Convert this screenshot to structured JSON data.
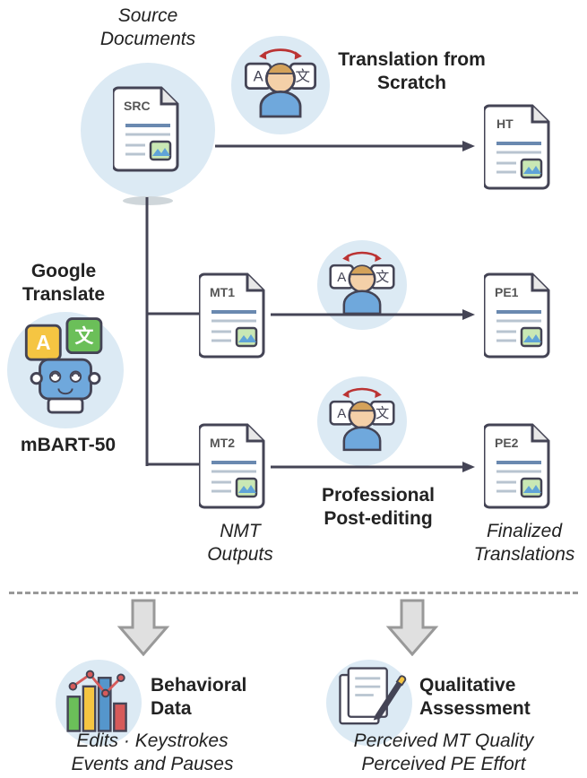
{
  "labels": {
    "source_documents": "Source Documents",
    "translation_from_scratch": "Translation from Scratch",
    "google_translate": "Google Translate",
    "mbart50": "mBART-50",
    "nmt_outputs": "NMT Outputs",
    "professional_postediting": "Professional Post-editing",
    "finalized_translations": "Finalized Translations",
    "behavioral_data": "Behavioral Data",
    "qualitative_assessment": "Qualitative Assessment",
    "edits_line": "Edits · Keystrokes Events and Pauses",
    "perceived_line": "Perceived MT Quality Perceived PE Effort"
  },
  "docs": {
    "src": "SRC",
    "ht": "HT",
    "mt1": "MT1",
    "mt2": "MT2",
    "pe1": "PE1",
    "pe2": "PE2"
  }
}
